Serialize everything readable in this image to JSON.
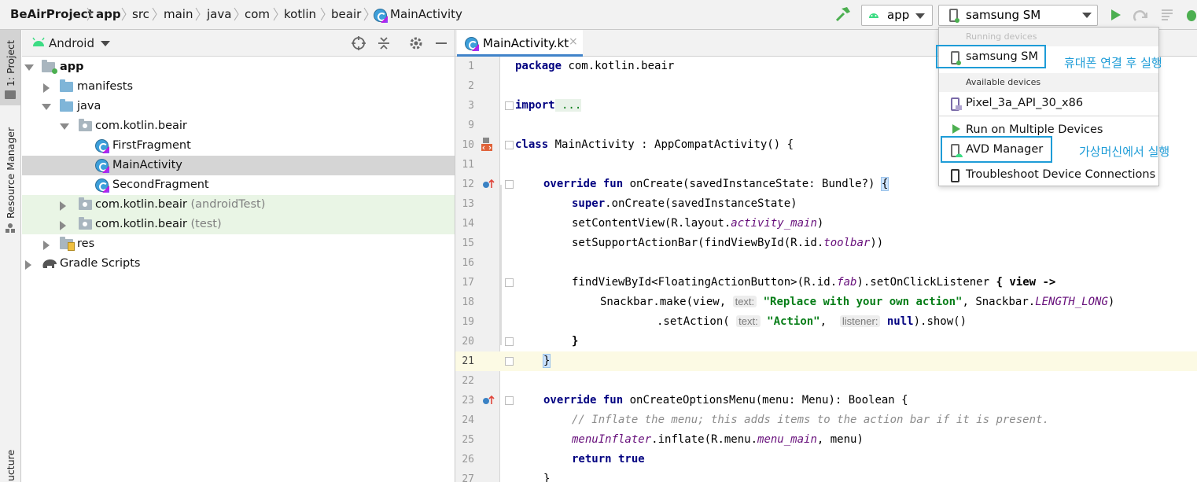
{
  "breadcrumb": [
    "BeAirProject",
    "app",
    "src",
    "main",
    "java",
    "com",
    "kotlin",
    "beair",
    "MainActivity"
  ],
  "toolbar": {
    "config": "app",
    "device": "samsung SM"
  },
  "left_tabs": {
    "project": "1: Project",
    "resource_manager": "Resource Manager",
    "structure": "ucture"
  },
  "project_panel": {
    "view_mode": "Android"
  },
  "tree": [
    {
      "label": "app",
      "extra": ""
    },
    {
      "label": "manifests",
      "extra": ""
    },
    {
      "label": "java",
      "extra": ""
    },
    {
      "label": "com.kotlin.beair",
      "extra": ""
    },
    {
      "label": "FirstFragment",
      "extra": ""
    },
    {
      "label": "MainActivity",
      "extra": ""
    },
    {
      "label": "SecondFragment",
      "extra": ""
    },
    {
      "label": "com.kotlin.beair",
      "extra": "(androidTest)"
    },
    {
      "label": "com.kotlin.beair",
      "extra": "(test)"
    },
    {
      "label": "res",
      "extra": ""
    },
    {
      "label": "Gradle Scripts",
      "extra": ""
    }
  ],
  "editor_tab": "MainActivity.kt",
  "line_numbers": [
    "1",
    "2",
    "3",
    "9",
    "10",
    "11",
    "12",
    "13",
    "14",
    "15",
    "16",
    "17",
    "18",
    "19",
    "20",
    "21",
    "22",
    "23",
    "24",
    "25",
    "26",
    "27"
  ],
  "code": {
    "l1_kw": "package",
    "l1_rest": " com.kotlin.beair",
    "l3_kw": "import",
    "l3_rest": " ...",
    "l10_kw": "class",
    "l10_rest": " MainActivity : AppCompatActivity() {",
    "l12_kw": "override fun",
    "l12_rest": " onCreate(savedInstanceState: Bundle?) ",
    "l12_brace": "{",
    "l13_kw": "super",
    "l13_rest": ".onCreate(savedInstanceState)",
    "l14_a": "setContentView(R.layout.",
    "l14_b": "activity_main",
    "l14_c": ")",
    "l15_a": "setSupportActionBar(findViewById(R.id.",
    "l15_b": "toolbar",
    "l15_c": "))",
    "l17_a": "findViewById<FloatingActionButton>(R.id.",
    "l17_b": "fab",
    "l17_c": ").setOnClickListener ",
    "l17_d": "{",
    "l17_e": " view ->",
    "l18_a": "Snackbar.make(view, ",
    "l18_hint": "text:",
    "l18_str": "\"Replace with your own action\"",
    "l18_b": ", Snackbar.",
    "l18_c": "LENGTH_LONG",
    "l18_d": ")",
    "l19_a": ".setAction( ",
    "l19_hint1": "text:",
    "l19_str": "\"Action\"",
    "l19_b": ",  ",
    "l19_hint2": "listener:",
    "l19_kw": "null",
    "l19_c": ").show()",
    "l20": "}",
    "l21": "}",
    "l23_kw": "override fun",
    "l23_rest": " onCreateOptionsMenu(menu: Menu): Boolean {",
    "l24": "// Inflate the menu; this adds items to the action bar if it is present.",
    "l25_a": "menuInflater",
    "l25_b": ".inflate(R.menu.",
    "l25_c": "menu_main",
    "l25_d": ", menu)",
    "l26_kw": "return true",
    "l27": "}"
  },
  "device_menu": {
    "running_header": "Running devices",
    "running_device": "samsung SM",
    "available_header": "Available devices",
    "available_device": "Pixel_3a_API_30_x86",
    "run_multiple": "Run on Multiple Devices",
    "avd_manager": "AVD Manager",
    "troubleshoot": "Troubleshoot Device Connections"
  },
  "annotations": {
    "phone": "휴대폰 연결 후 실행",
    "avd": "가상머신에서 실행"
  },
  "colors": {
    "accent": "#1e9cd7",
    "keyword": "#000080",
    "string": "#067d17",
    "run": "#4caf50"
  }
}
